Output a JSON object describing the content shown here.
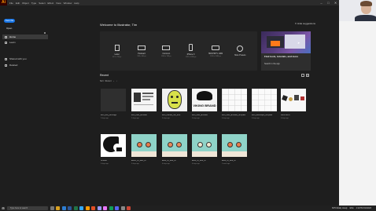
{
  "menubar": {
    "logo": "Ai",
    "menus": [
      "File",
      "Edit",
      "Object",
      "Type",
      "Select",
      "Effect",
      "View",
      "Window",
      "Help"
    ],
    "controls": {
      "minimize": "–",
      "maximize": "□",
      "close": "✕"
    }
  },
  "sidebar": {
    "new_label": "New file",
    "open_label": "Open",
    "items": [
      {
        "label": "Home",
        "icon": "home-icon"
      },
      {
        "label": "Learn",
        "icon": "learn-icon"
      },
      {
        "label": "Shared with you",
        "icon": "shared-icon"
      },
      {
        "label": "Deleted",
        "icon": "trash-icon"
      }
    ]
  },
  "main": {
    "welcome": "Welcome to Illustrator, Tim",
    "hide_suggestions": "Hide suggestions",
    "presets": [
      {
        "name": "Letter",
        "sub": "612 x 792 pt",
        "icon": "document-icon"
      },
      {
        "name": "Postcard",
        "sub": "288 x 560 pt",
        "icon": "postcard-icon"
      },
      {
        "name": "Common",
        "sub": "1366 x 768 px",
        "icon": "screen-icon"
      },
      {
        "name": "iPhone X",
        "sub": "1125 x 2436 px",
        "icon": "phone-icon"
      },
      {
        "name": "HDV/HDTV 1080",
        "sub": "1920 x 1080 px",
        "icon": "video-icon"
      },
      {
        "name": "More Presets",
        "sub": "",
        "icon": "more-icon"
      }
    ],
    "promo": {
      "title": "Find tools, tutorials, and more",
      "link": "Search in the app"
    },
    "recent": {
      "title": "Recent",
      "sort_label": "Sort",
      "sort_value": "Recent",
      "files": [
        {
          "name": "ai00_test_pdfimage",
          "date": "2 days ago"
        },
        {
          "name": "ai00_utah_artboard",
          "date": "2 days ago"
        },
        {
          "name": "ai00_celeste_mill_time",
          "date": "3 days ago"
        },
        {
          "name": "ai00_utah_artboard",
          "date": "3 days ago"
        },
        {
          "name": "ai00_utah_artboard_template",
          "date": "4 days ago"
        },
        {
          "name": "ai00_landscape_template",
          "date": "4 days ago"
        },
        {
          "name": "WESTERN",
          "date": "4 days ago"
        },
        {
          "name": "Untitled",
          "date": "5 days ago"
        },
        {
          "name": "Editor_AI_face_AI",
          "date": "5 days ago"
        },
        {
          "name": "Edits_AI_face_AI",
          "date": "6 days ago"
        },
        {
          "name": "Edits_AI_face_AI",
          "date": "6 days ago"
        },
        {
          "name": "Edits_AI_face_AI",
          "date": "1 week ago"
        }
      ],
      "viking_text": "VIKING BRAND"
    }
  },
  "taskbar": {
    "search_placeholder": "Type here to search",
    "tray_weather": "60°F Mostly cloudy",
    "tray_lang": "ENG",
    "clock": "4:12 PM 6/14/2023"
  },
  "colors": {
    "accent": "#1473e6",
    "app_bg": "#1e1e1e",
    "panel_bg": "#262626"
  }
}
